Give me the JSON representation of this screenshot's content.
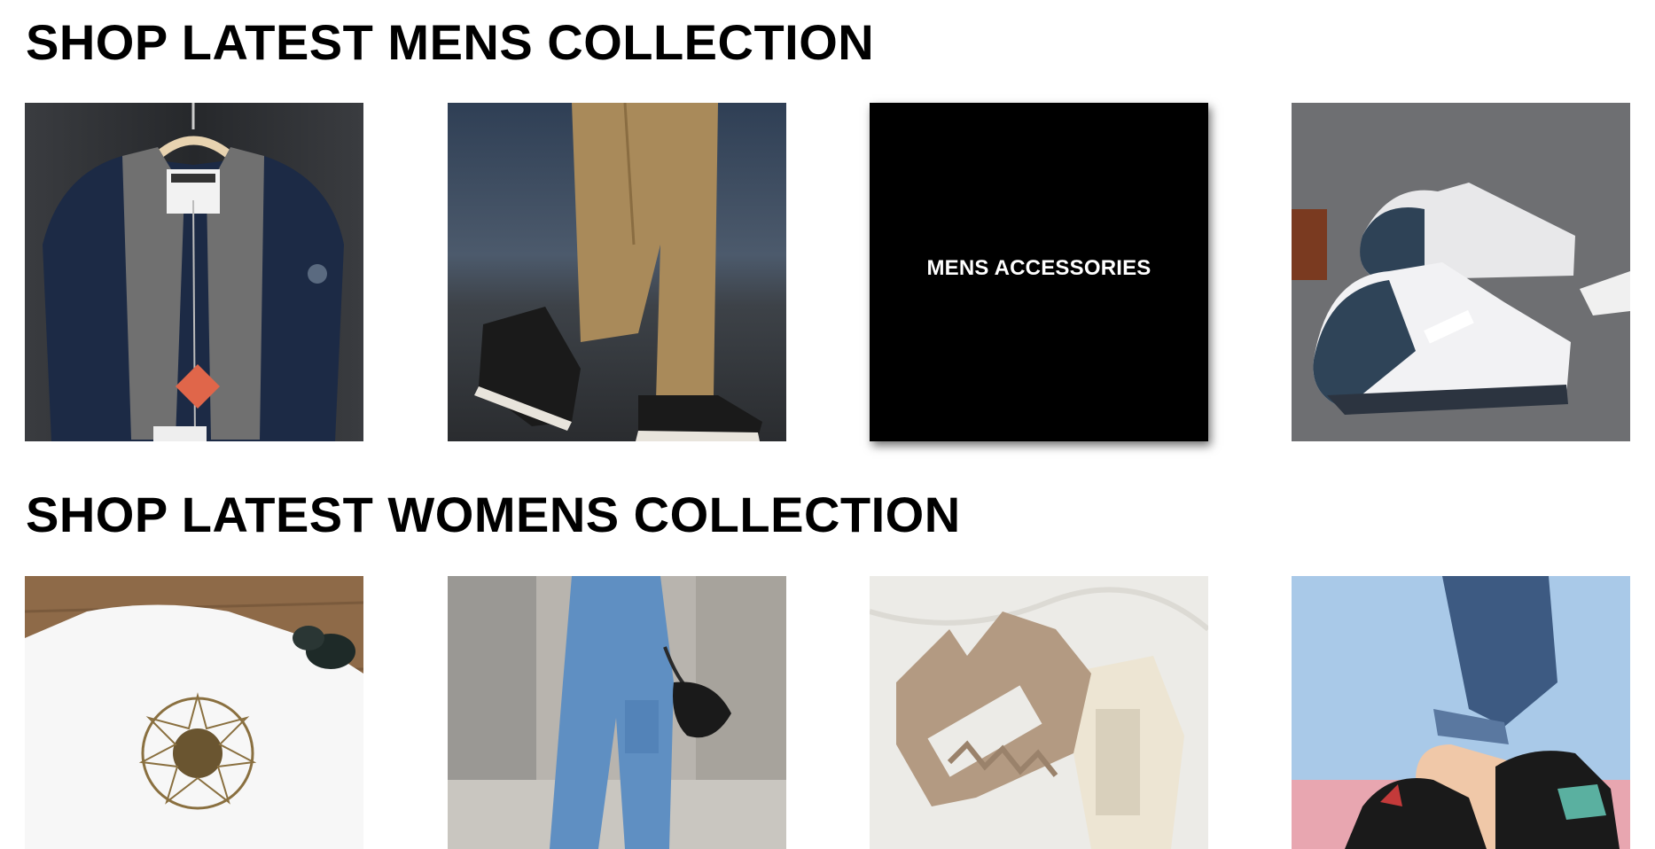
{
  "mens": {
    "title": "SHOP LATEST MENS COLLECTION",
    "tiles": [
      {
        "name": "mens-jacket",
        "alt": "Navy fleece jacket on hanger"
      },
      {
        "name": "mens-pants",
        "alt": "Khaki cargo pants with sneakers"
      },
      {
        "name": "mens-accessories",
        "label": "MENS ACCESSORIES"
      },
      {
        "name": "mens-sneakers",
        "alt": "White and blue sneakers"
      }
    ]
  },
  "womens": {
    "title": "SHOP LATEST WOMENS COLLECTION",
    "tiles": [
      {
        "name": "womens-tshirt",
        "alt": "White t-shirt with sunflower print"
      },
      {
        "name": "womens-jeans",
        "alt": "Blue cargo jeans with handbag"
      },
      {
        "name": "womens-hair-claws",
        "alt": "Hair claw clips"
      },
      {
        "name": "womens-sneakers",
        "alt": "Black sneakers"
      }
    ]
  },
  "colors": {
    "accent_black": "#000000",
    "background": "#ffffff"
  }
}
